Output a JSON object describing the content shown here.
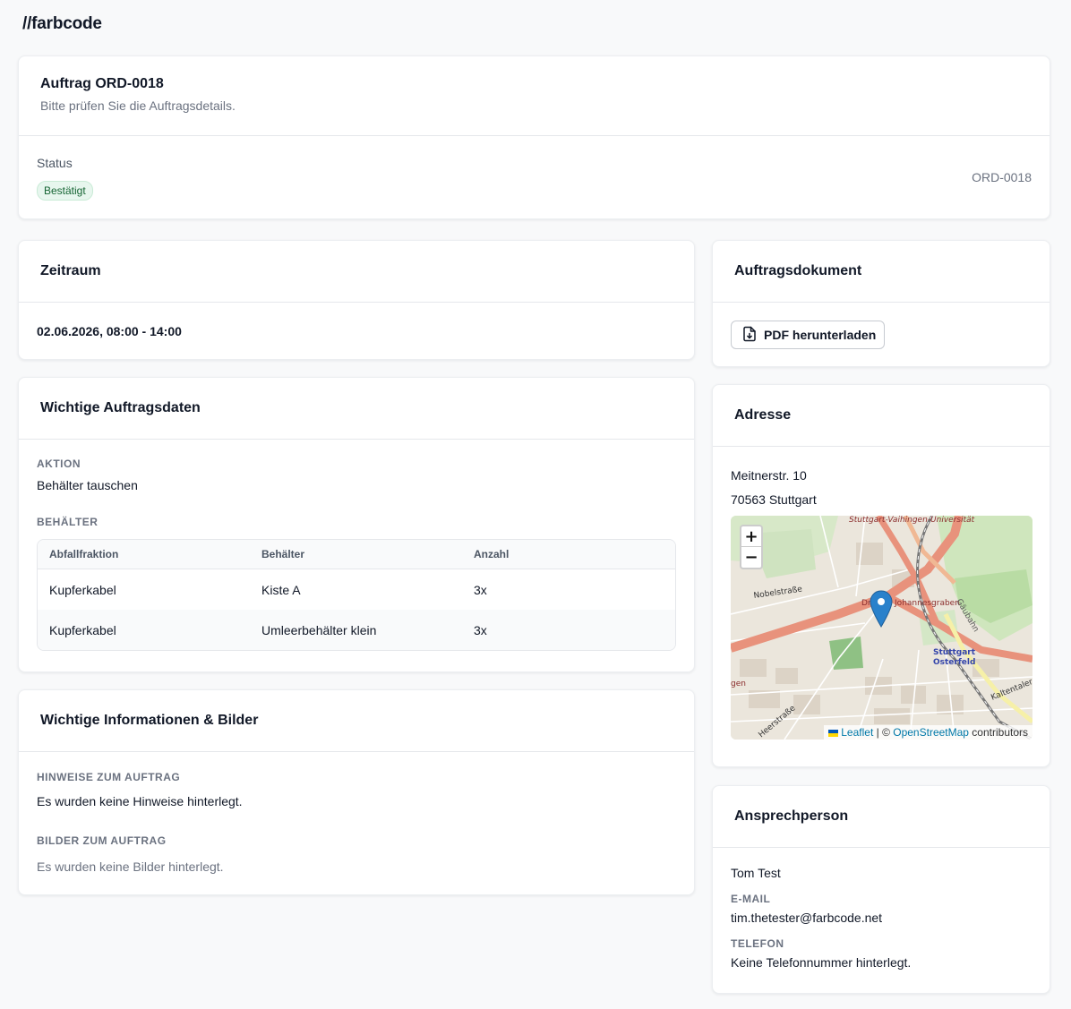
{
  "brand": "//farbcode",
  "order": {
    "title": "Auftrag ORD-0018",
    "subtitle": "Bitte prüfen Sie die Auftragsdetails.",
    "status_label": "Status",
    "status_value": "Bestätigt",
    "id": "ORD-0018"
  },
  "timeframe": {
    "title": "Zeitraum",
    "value": "02.06.2026, 08:00 - 14:00"
  },
  "key_data": {
    "title": "Wichtige Auftragsdaten",
    "action_label": "Aktion",
    "action_value": "Behälter tauschen",
    "containers_label": "Behälter",
    "table": {
      "headers": [
        "Abfallfraktion",
        "Behälter",
        "Anzahl"
      ],
      "rows": [
        [
          "Kupferkabel",
          "Kiste A",
          "3x"
        ],
        [
          "Kupferkabel",
          "Umleerbehälter klein",
          "3x"
        ]
      ]
    }
  },
  "info": {
    "title": "Wichtige Informationen & Bilder",
    "notes_label": "Hinweise zum Auftrag",
    "notes_value": "Es wurden keine Hinweise hinterlegt.",
    "images_label": "Bilder zum Auftrag",
    "images_value": "Es wurden keine Bilder hinterlegt."
  },
  "document": {
    "title": "Auftragsdokument",
    "button_label": "PDF herunterladen"
  },
  "address": {
    "title": "Adresse",
    "street": "Meitnerstr. 10",
    "city": "70563 Stuttgart",
    "map": {
      "zoom_in": "+",
      "zoom_out": "−",
      "labels": {
        "top": "Stuttgart-Vaihingen-Universität",
        "nobel": "Nobelstraße",
        "johannes": "Dreieck Johannesgraben",
        "gaeubahn": "Gäubahn",
        "osterfeld_1": "Stuttgart",
        "osterfeld_2": "Osterfeld",
        "heer": "Heerstraße",
        "kalten": "Kaltentaler",
        "left_cut": "gen"
      },
      "attribution": {
        "leaflet": "Leaflet",
        "sep": " | © ",
        "osm": "OpenStreetMap",
        "contributors": " contributors"
      }
    }
  },
  "contact": {
    "title": "Ansprechperson",
    "name": "Tom Test",
    "email_label": "E-Mail",
    "email_value": "tim.thetester@farbcode.net",
    "phone_label": "Telefon",
    "phone_value": "Keine Telefonnummer hinterlegt."
  },
  "colors": {
    "accent_badge_bg": "#e7f6ee",
    "accent_badge_text": "#166534",
    "map_marker": "#2a81cb",
    "link": "#0078a8"
  }
}
